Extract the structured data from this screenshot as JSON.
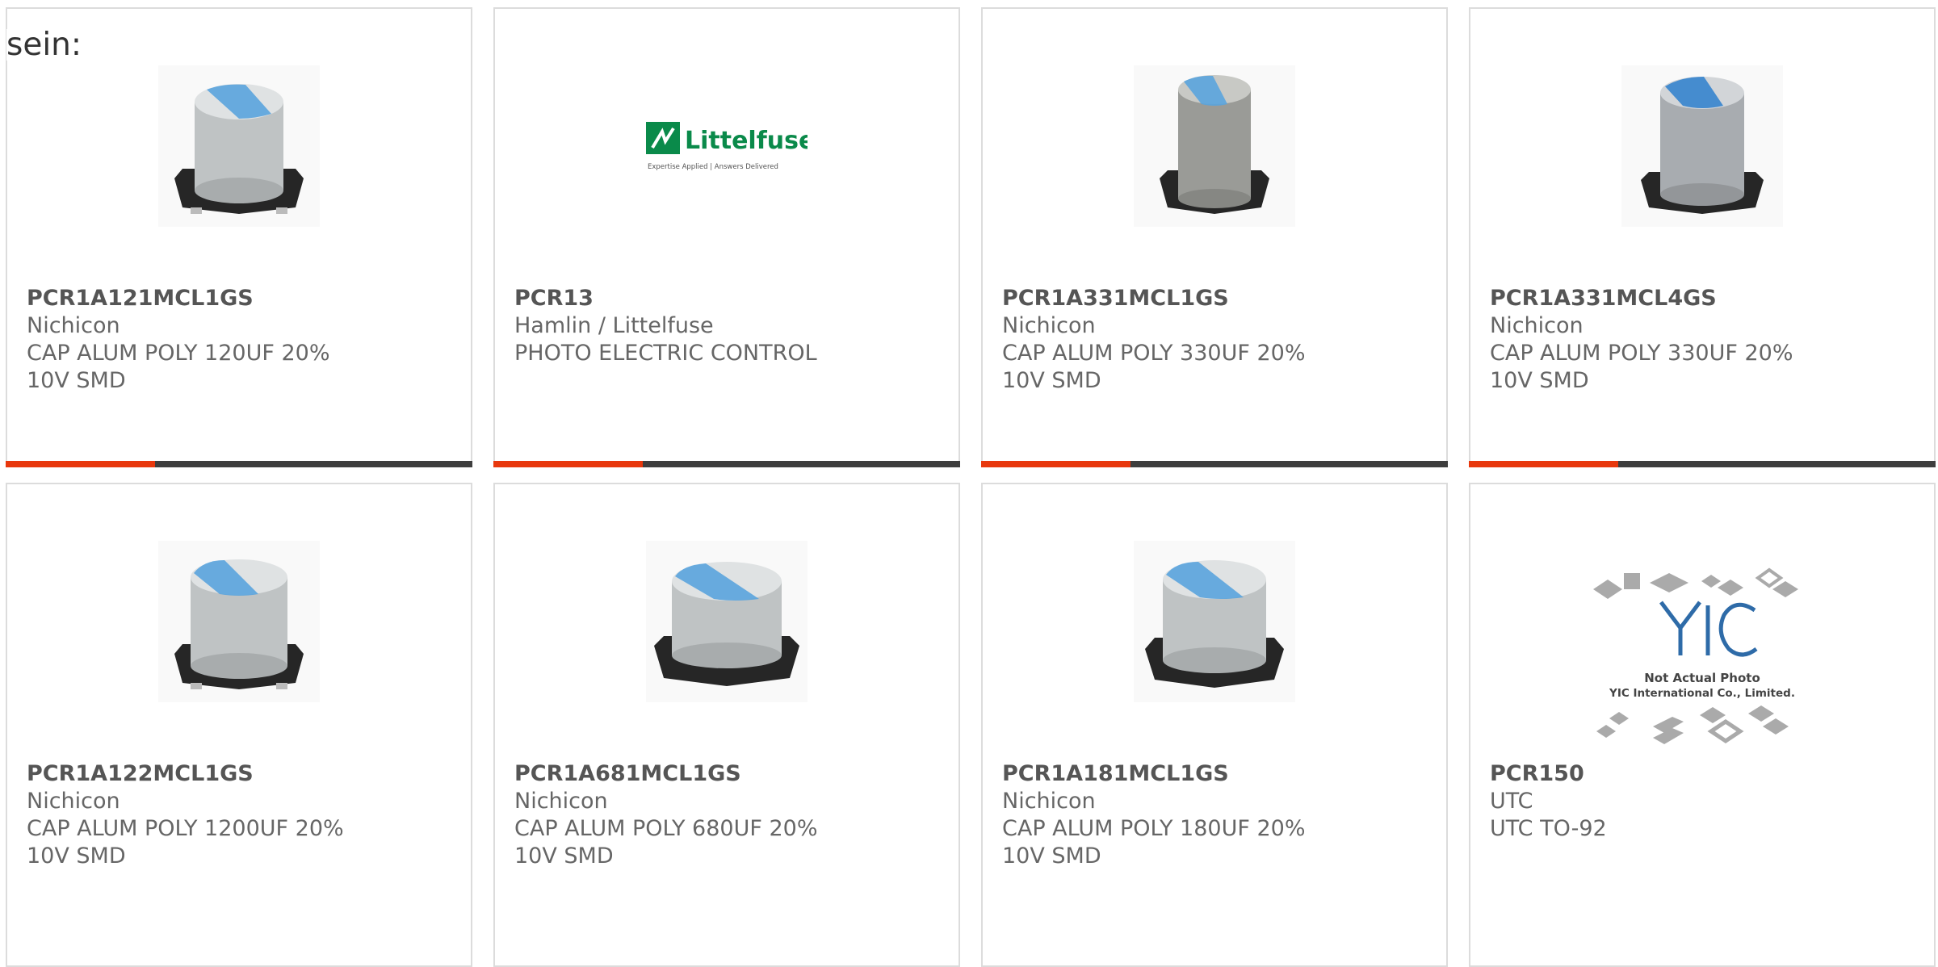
{
  "intro": {
    "text": "sein:"
  },
  "colors": {
    "accent": "#e8380d",
    "bar": "#3e3e3e",
    "border": "#dcdcdc",
    "capacitor_top": "#5aa4dd"
  },
  "products": [
    {
      "part": "PCR1A121MCL1GS",
      "maker": "Nichicon",
      "desc": "CAP ALUM POLY 120UF 20% 10V SMD",
      "image": "capacitor-image"
    },
    {
      "part": "PCR13",
      "maker": "Hamlin / Littelfuse",
      "desc": "PHOTO ELECTRIC CONTROL",
      "image": "littelfuse-logo",
      "logo": {
        "name": "Littelfuse",
        "tagline": "Expertise Applied | Answers Delivered"
      }
    },
    {
      "part": "PCR1A331MCL1GS",
      "maker": "Nichicon",
      "desc": "CAP ALUM POLY 330UF 20% 10V SMD",
      "image": "capacitor-image"
    },
    {
      "part": "PCR1A331MCL4GS",
      "maker": "Nichicon",
      "desc": "CAP ALUM POLY 330UF 20% 10V SMD",
      "image": "capacitor-image"
    },
    {
      "part": "PCR1A122MCL1GS",
      "maker": "Nichicon",
      "desc": "CAP ALUM POLY 1200UF 20% 10V SMD",
      "image": "capacitor-image"
    },
    {
      "part": "PCR1A681MCL1GS",
      "maker": "Nichicon",
      "desc": "CAP ALUM POLY 680UF 20% 10V SMD",
      "image": "capacitor-image"
    },
    {
      "part": "PCR1A181MCL1GS",
      "maker": "Nichicon",
      "desc": "CAP ALUM POLY 180UF 20% 10V SMD",
      "image": "capacitor-image"
    },
    {
      "part": "PCR150",
      "maker": "UTC",
      "desc": "UTC TO-92",
      "image": "not-actual-photo",
      "placeholder": {
        "logo": "YIC",
        "line1": "Not Actual Photo",
        "line2": "YIC International Co., Limited."
      }
    }
  ]
}
